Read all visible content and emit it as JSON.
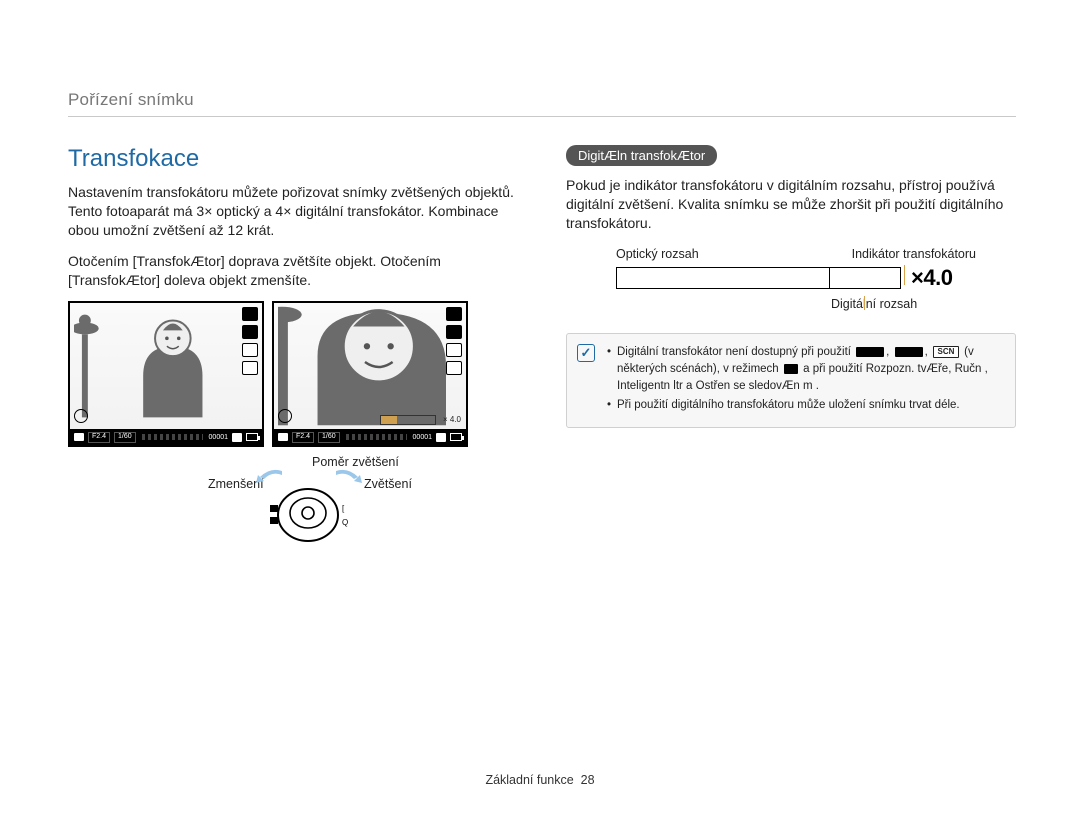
{
  "section_title": "Pořízení snímku",
  "left": {
    "heading": "Transfokace",
    "p1": "Nastavením transfokátoru můžete pořizovat snímky zvětšených objektů. Tento fotoaparát má 3× optický a 4× digitální transfokátor. Kombinace obou umožní zvětšení až 12 krát.",
    "p2": "Otočením [TransfokÆtor] doprava zvětšíte objekt. Otočením [TransfokÆtor] doleva objekt zmenšíte.",
    "status": {
      "f": "F2.4",
      "shutter": "1/60",
      "counter": "00001"
    },
    "zoom_value": "× 4.0",
    "labels": {
      "ratio": "Poměr zvětšení",
      "zoom_out": "Zmenšení",
      "zoom_in": "Zvětšení"
    }
  },
  "right": {
    "pill": "DigitÆln  transfokÆtor",
    "p1": "Pokud je indikátor transfokátoru v digitálním rozsahu, přístroj používá digitální zvětšení. Kvalita snímku se může zhoršit při použití digitálního transfokátoru.",
    "diagram": {
      "optical": "Optický rozsah",
      "indicator": "Indikátor transfokátoru",
      "digital": "Digitální rozsah",
      "x40": "4.0"
    },
    "notes": {
      "n1a": "Digitální transfokátor není dostupný při použití ",
      "n1b": " (v některých scénách), v režimech ",
      "n1c": " a při použití Rozpozn. tvÆře, Ručn , Inteligentn  ltr a Ostřen  se sledovÆn m .",
      "n2": "Při použití digitálního transfokátoru může uložení snímku trvat déle."
    }
  },
  "footer": {
    "label": "Základní funkce",
    "page": "28"
  },
  "chart_data": {
    "type": "bar",
    "title": "Zoom range indicator",
    "categories": [
      "Optický rozsah",
      "Digitální rozsah"
    ],
    "values": [
      3,
      4
    ],
    "annotation": "× 4.0",
    "xlabel": "",
    "ylabel": "",
    "note": "Horizontal stacked-range bar; optical segment ≈ 3/4 width, digital ≈ 1/4; indicator tick at boundary; value badge to the right reads × 4.0."
  }
}
